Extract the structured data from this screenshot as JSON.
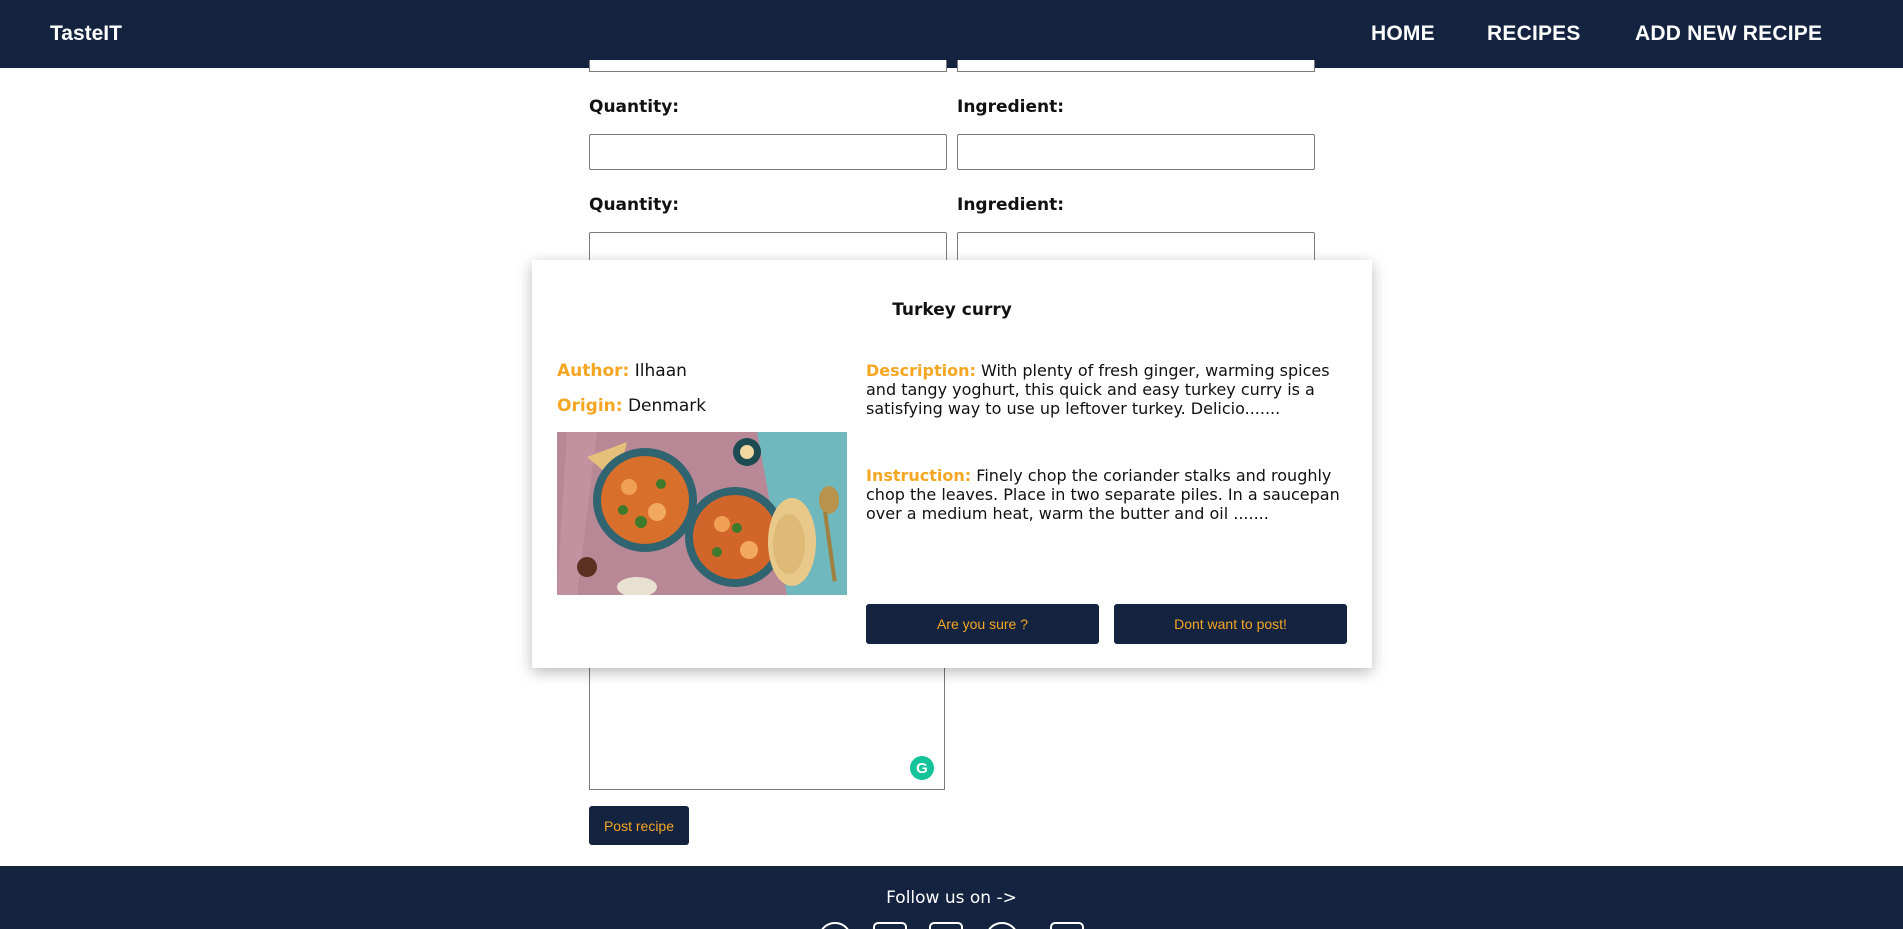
{
  "header": {
    "brand": "TasteIT",
    "nav": [
      "HOME",
      "RECIPES",
      "ADD NEW RECIPE"
    ]
  },
  "form": {
    "quantity_label": "Quantity:",
    "ingredient_label": "Ingredient:",
    "post_button": "Post recipe"
  },
  "modal": {
    "title": "Turkey curry",
    "author_key": "Author:",
    "author": "Ilhaan",
    "origin_key": "Origin:",
    "origin": "Denmark",
    "description_key": "Description:",
    "description": "With plenty of fresh ginger, warming spices and tangy yoghurt, this quick and easy turkey curry is a satisfying way to use up leftover turkey. Delicio.......",
    "instruction_key": "Instruction:",
    "instruction": "Finely chop the coriander stalks and roughly chop the leaves. Place in two separate piles. In a saucepan over a medium heat, warm the butter and oil .......",
    "confirm_button": "Are you sure ?",
    "cancel_button": "Dont want to post!",
    "image_subject": "turkey curry bowls with naan bread"
  },
  "footer": {
    "follow": "Follow us on ->",
    "social_icons": [
      "facebook-icon",
      "instagram-icon",
      "linkedin-icon",
      "pinterest-icon",
      "youtube-icon"
    ]
  },
  "colors": {
    "navy": "#14233f",
    "accent": "#f5a623"
  }
}
